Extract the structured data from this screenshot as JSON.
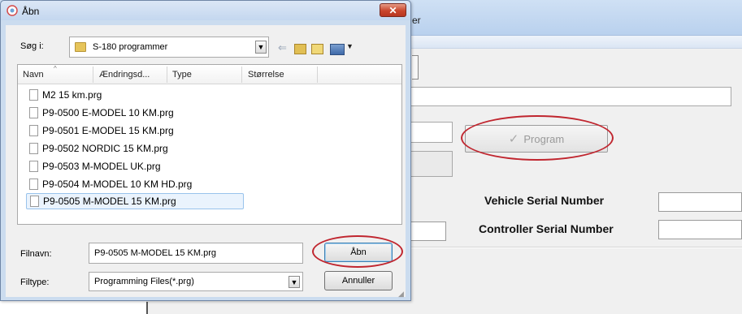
{
  "background_app": {
    "title_fragment": "er",
    "program_button_label": "Program",
    "vehicle_serial_label": "Vehicle Serial Number",
    "controller_serial_label": "Controller Serial Number",
    "vehicle_serial_value": "",
    "controller_serial_value": ""
  },
  "dialog": {
    "title": "Åbn",
    "close_glyph": "✕",
    "look_in_label": "Søg i:",
    "look_in_value": "S-180 programmer",
    "columns": [
      "Navn",
      "Ændringsd...",
      "Type",
      "Størrelse"
    ],
    "files": [
      "M2 15 km.prg",
      "P9-0500 E-MODEL 10 KM.prg",
      "P9-0501 E-MODEL 15 KM.prg",
      "P9-0502 NORDIC 15 KM.prg",
      "P9-0503 M-MODEL UK.prg",
      "P9-0504 M-MODEL 10 KM HD.prg",
      "P9-0505 M-MODEL 15 KM.prg"
    ],
    "selected_index": 6,
    "filename_label": "Filnavn:",
    "filename_value": "P9-0505 M-MODEL 15 KM.prg",
    "filetype_label": "Filtype:",
    "filetype_value": "Programming Files(*.prg)",
    "open_button": "Åbn",
    "cancel_button": "Annuller"
  },
  "icons": {
    "app": "folder-globe-icon",
    "folder": "folder-icon",
    "back": "back-arrow-icon",
    "up": "up-folder-icon",
    "new_folder": "new-folder-icon",
    "views": "views-menu-icon",
    "file": "file-icon",
    "check": "checkmark-icon"
  },
  "colors": {
    "highlight_ellipse": "#c0262f",
    "selection": "#eaf3fd",
    "close_button": "#c9452c"
  }
}
